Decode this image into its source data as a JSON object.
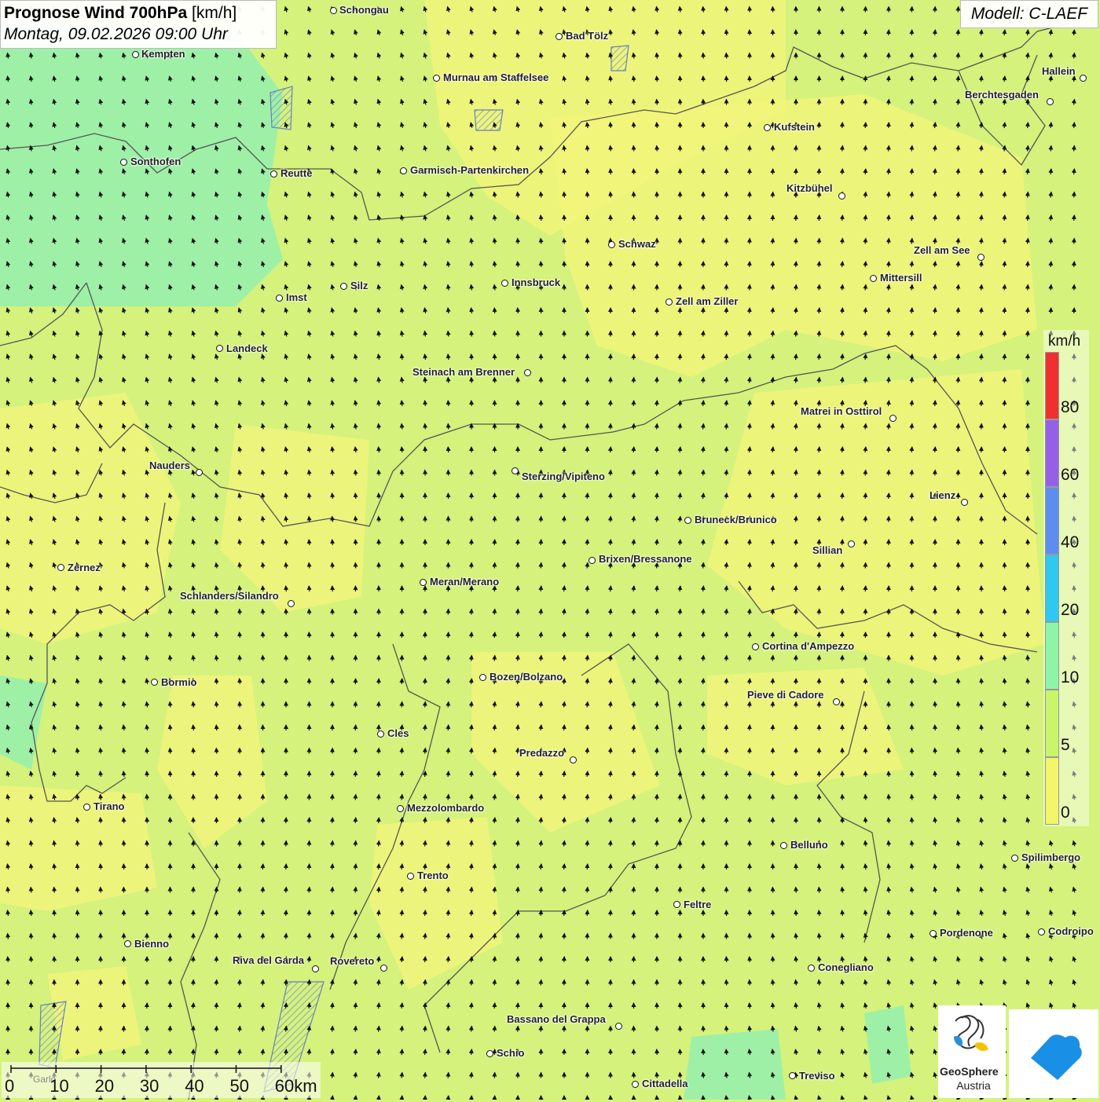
{
  "header": {
    "title_bold": "Prognose Wind 700hPa",
    "title_unit": "[km/h]",
    "datetime": "Montag, 09.02.2026 09:00 Uhr",
    "model": "Modell: C-LAEF"
  },
  "colors": {
    "background": "#d9f27a",
    "calm": "#f4f57a",
    "green": "#c6f27a",
    "teal": "#9ef0a6",
    "border": "#555555",
    "arrow": "#111111"
  },
  "map": {
    "wind_direction": "from south-southeast toward north-northwest",
    "cities": [
      {
        "name": "Schongau"
      },
      {
        "name": "Bad Tölz"
      },
      {
        "name": "Kempten"
      },
      {
        "name": "Murnau am Staffelsee"
      },
      {
        "name": "Hallein"
      },
      {
        "name": "Berchtesgaden"
      },
      {
        "name": "Kufstein"
      },
      {
        "name": "Sonthofen"
      },
      {
        "name": "Reutte"
      },
      {
        "name": "Garmisch-Partenkirchen"
      },
      {
        "name": "Kitzbühel"
      },
      {
        "name": "Schwaz"
      },
      {
        "name": "Zell am See"
      },
      {
        "name": "Innsbruck"
      },
      {
        "name": "Mittersill"
      },
      {
        "name": "Silz"
      },
      {
        "name": "Imst"
      },
      {
        "name": "Zell am Ziller"
      },
      {
        "name": "Landeck"
      },
      {
        "name": "Steinach am Brenner"
      },
      {
        "name": "Matrei in Osttirol"
      },
      {
        "name": "Nauders"
      },
      {
        "name": "Sterzing/Vipiteno"
      },
      {
        "name": "Lienz"
      },
      {
        "name": "Bruneck/Brunico"
      },
      {
        "name": "Sillian"
      },
      {
        "name": "Brixen/Bressanone"
      },
      {
        "name": "Zernez"
      },
      {
        "name": "Meran/Merano"
      },
      {
        "name": "Schlanders/Silandro"
      },
      {
        "name": "Cortina d'Ampezzo"
      },
      {
        "name": "Bormio"
      },
      {
        "name": "Bozen/Bolzano"
      },
      {
        "name": "Pieve di Cadore"
      },
      {
        "name": "Cles"
      },
      {
        "name": "Predazzo"
      },
      {
        "name": "Tirano"
      },
      {
        "name": "Mezzolombardo"
      },
      {
        "name": "Belluno"
      },
      {
        "name": "Spilimbergo"
      },
      {
        "name": "Trento"
      },
      {
        "name": "Feltre"
      },
      {
        "name": "Pordenone"
      },
      {
        "name": "Codroipo"
      },
      {
        "name": "Bienno"
      },
      {
        "name": "Riva del Garda"
      },
      {
        "name": "Rovereto"
      },
      {
        "name": "Conegliano"
      },
      {
        "name": "Bassano del Grappa"
      },
      {
        "name": "Schio"
      },
      {
        "name": "Treviso"
      },
      {
        "name": "Cittadella"
      }
    ]
  },
  "legend": {
    "unit": "km/h",
    "bins": [
      {
        "color": "#f3f56a",
        "label": "0"
      },
      {
        "color": "#c8f56a",
        "label": "5"
      },
      {
        "color": "#8ef5a8",
        "label": "10"
      },
      {
        "color": "#2fc8f0",
        "label": "20"
      },
      {
        "color": "#5c8ef0",
        "label": "40"
      },
      {
        "color": "#9660e6",
        "label": "60"
      },
      {
        "color": "#f03030",
        "label": "80"
      }
    ]
  },
  "scalebar": {
    "labels": [
      "0",
      "10",
      "20",
      "30",
      "40",
      "50",
      "60km"
    ],
    "underlay_text": "Garlo"
  },
  "logos": {
    "geosphere_name": "GeoSphere",
    "geosphere_sub": "Austria"
  }
}
